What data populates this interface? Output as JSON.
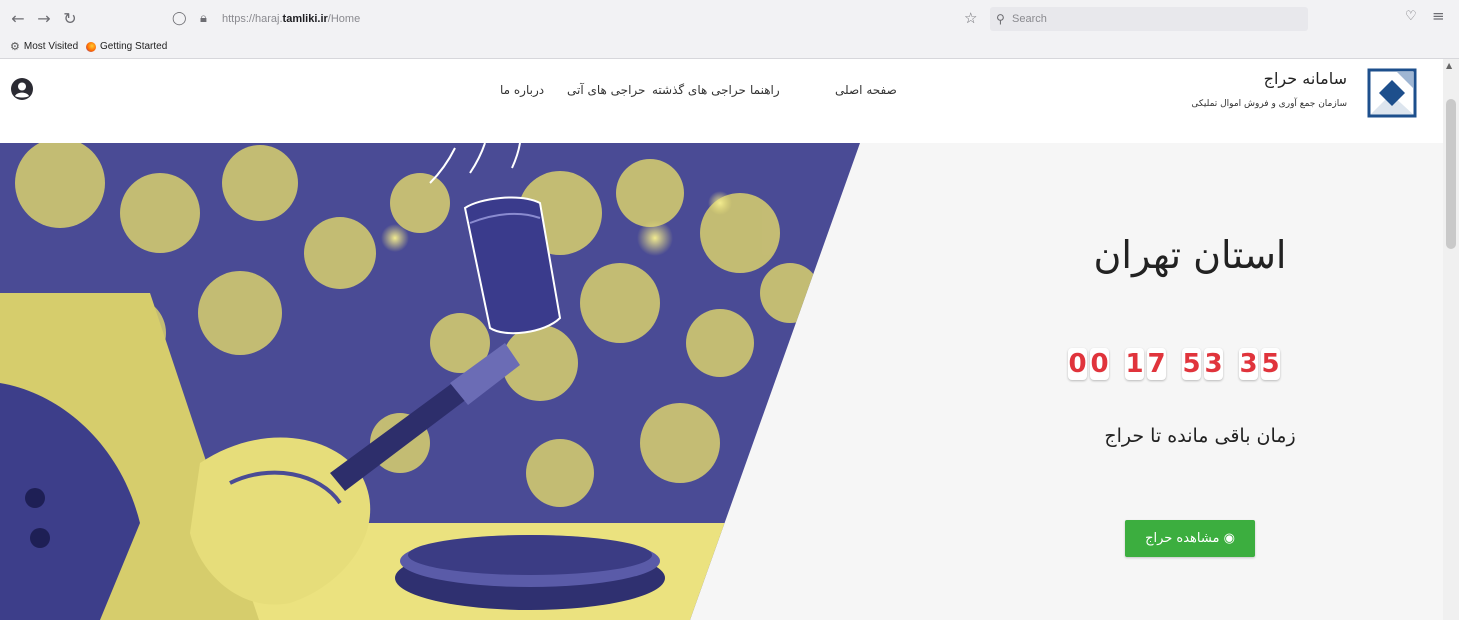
{
  "browser": {
    "back_icon": "arrow-left-icon",
    "forward_icon": "arrow-right-icon",
    "reload_icon": "reload-icon",
    "url_prefix": "https://haraj.",
    "url_domain": "tamliki.ir",
    "url_path": "/Home",
    "search_placeholder": "Search",
    "bookmarks": [
      {
        "label": "Most Visited"
      },
      {
        "label": "Getting Started"
      }
    ]
  },
  "header": {
    "brand_title": "سامانه حراج",
    "brand_subtitle": "سازمان جمع آوری و فروش اموال تملیکی",
    "nav": [
      {
        "label": "صفحه اصلی"
      },
      {
        "label": "راهنما"
      },
      {
        "label": "حراجی های گذشته"
      },
      {
        "label": "حراجی های آتی"
      },
      {
        "label": "درباره ما"
      }
    ]
  },
  "hero": {
    "province": "استان تهران",
    "countdown": [
      "0",
      "0",
      "1",
      "7",
      "5",
      "3",
      "3",
      "5"
    ],
    "remaining_label": "زمان باقی مانده تا حراج",
    "view_button": "مشاهده حراج"
  },
  "colors": {
    "accent_green": "#3cae3f",
    "countdown_red": "#e0343c",
    "photo_yellow": "#e8df7a",
    "photo_blue": "#3a3b8c"
  }
}
